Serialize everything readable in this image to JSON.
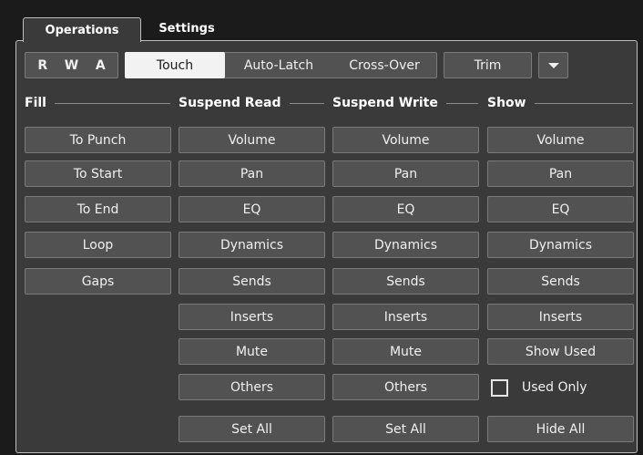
{
  "tabs": {
    "operations": "Operations",
    "settings": "Settings"
  },
  "toolbar": {
    "r": "R",
    "w": "W",
    "a": "A",
    "modes": [
      "Touch",
      "Auto-Latch",
      "Cross-Over"
    ],
    "selected_mode": "Touch",
    "trim": "Trim",
    "dropdown_icon": "caret-down-icon"
  },
  "sections": {
    "fill": "Fill",
    "suspend_read": "Suspend Read",
    "suspend_write": "Suspend Write",
    "show": "Show"
  },
  "fill": [
    "To Punch",
    "To Start",
    "To End",
    "Loop",
    "Gaps"
  ],
  "suspend_read": [
    "Volume",
    "Pan",
    "EQ",
    "Dynamics",
    "Sends",
    "Inserts",
    "Mute",
    "Others",
    "Set All"
  ],
  "suspend_write": [
    "Volume",
    "Pan",
    "EQ",
    "Dynamics",
    "Sends",
    "Inserts",
    "Mute",
    "Others",
    "Set All"
  ],
  "show": [
    "Volume",
    "Pan",
    "EQ",
    "Dynamics",
    "Sends",
    "Inserts",
    "Show Used",
    "Hide All"
  ],
  "used_only": {
    "label": "Used Only",
    "checked": false
  }
}
